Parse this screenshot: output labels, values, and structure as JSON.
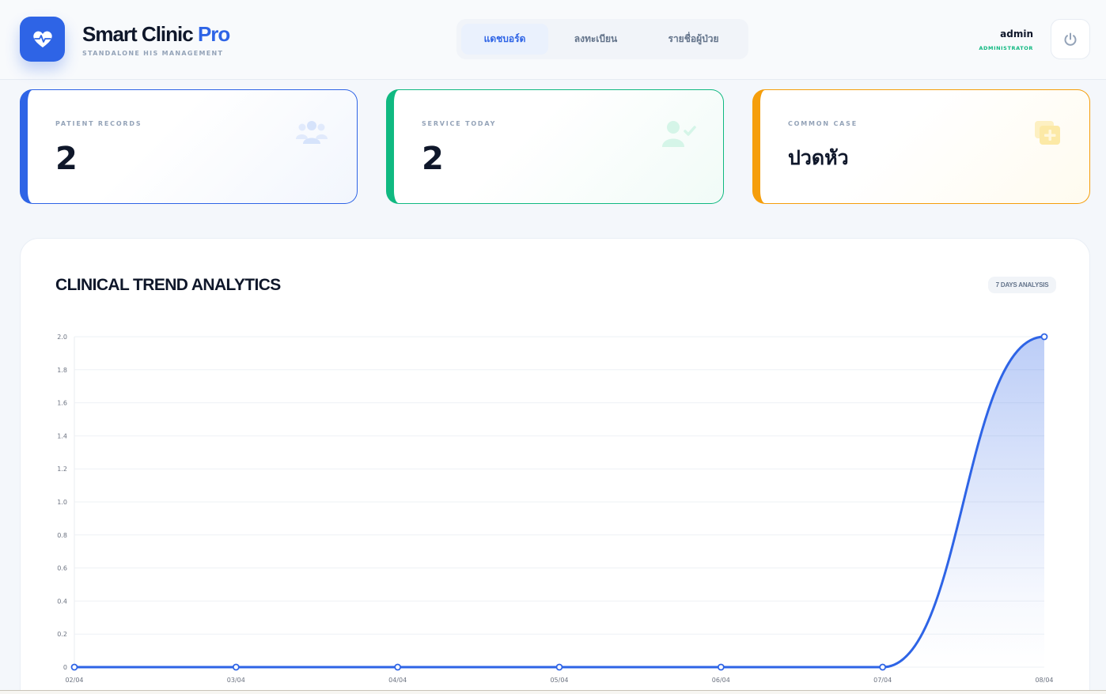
{
  "brand": {
    "name": "Smart Clinic",
    "name_accent": "Pro",
    "subtitle": "STANDALONE HIS MANAGEMENT",
    "logo_icon": "heart-pulse-icon"
  },
  "nav": {
    "items": [
      {
        "label": "แดชบอร์ด",
        "active": true
      },
      {
        "label": "ลงทะเบียน",
        "active": false
      },
      {
        "label": "รายชื่อผู้ป่วย",
        "active": false
      }
    ]
  },
  "user": {
    "name": "admin",
    "role": "ADMINISTRATOR",
    "logout_icon": "power-icon"
  },
  "stats": [
    {
      "label": "PATIENT RECORDS",
      "value": "2",
      "icon": "users-icon",
      "color": "#2e64e6"
    },
    {
      "label": "SERVICE TODAY",
      "value": "2",
      "icon": "user-check-icon",
      "color": "#10b981"
    },
    {
      "label": "COMMON CASE",
      "value": "ปวดหัว",
      "icon": "medical-notes-icon",
      "color": "#f59e0b"
    }
  ],
  "panel": {
    "title": "CLINICAL TREND ANALYTICS",
    "badge": "7 DAYS ANALYSIS"
  },
  "chart_data": {
    "type": "line",
    "categories": [
      "02/04",
      "03/04",
      "04/04",
      "05/04",
      "06/04",
      "07/04",
      "08/04"
    ],
    "series": [
      {
        "values": [
          0,
          0,
          0,
          0,
          0,
          0,
          2
        ],
        "color": "#2e64e6"
      }
    ],
    "yticks": [
      "0",
      "0.2",
      "0.4",
      "0.6",
      "0.8",
      "1.0",
      "1.2",
      "1.4",
      "1.6",
      "1.8",
      "2.0"
    ],
    "ylim": [
      0,
      2
    ],
    "grid": true,
    "fill": true
  }
}
